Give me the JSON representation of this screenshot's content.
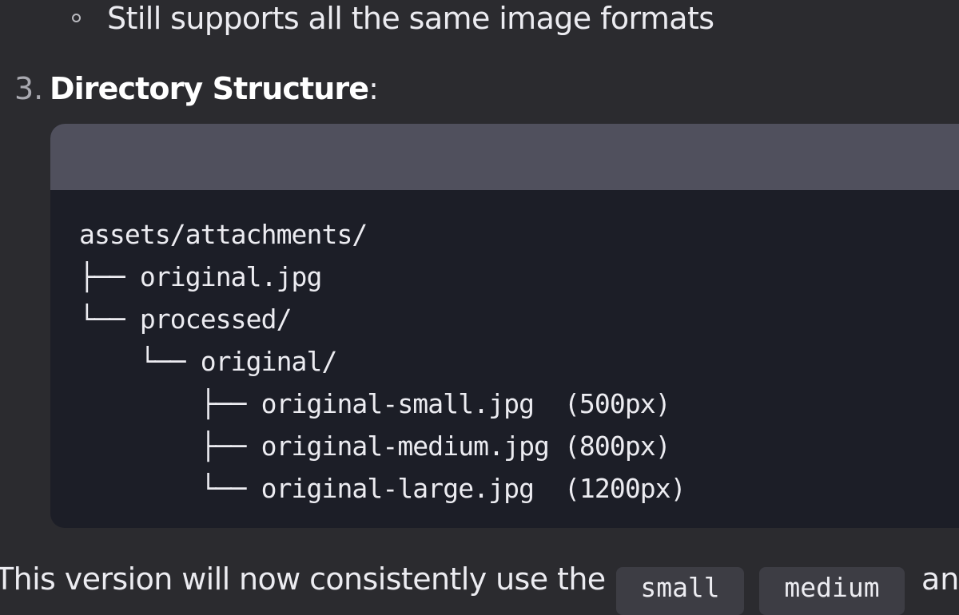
{
  "bullet_item": {
    "text": "Still supports all the same image formats"
  },
  "numbered_item": {
    "number": "3.",
    "title": "Directory Structure",
    "suffix": ":"
  },
  "code_block": {
    "lines": [
      "assets/attachments/",
      "├── original.jpg",
      "└── processed/",
      "    └── original/",
      "        ├── original-small.jpg  (500px)",
      "        ├── original-medium.jpg (800px)",
      "        └── original-large.jpg  (1200px)"
    ]
  },
  "bottom_paragraph": {
    "text": "This version will now consistently use the",
    "inline_code_1": "small",
    "inline_code_2": "medium",
    "tail": "an"
  },
  "colors": {
    "background": "#2b2b2f",
    "code_background": "#1c1e27",
    "code_header": "#50505d",
    "inline_code_background": "#3d3d44"
  }
}
